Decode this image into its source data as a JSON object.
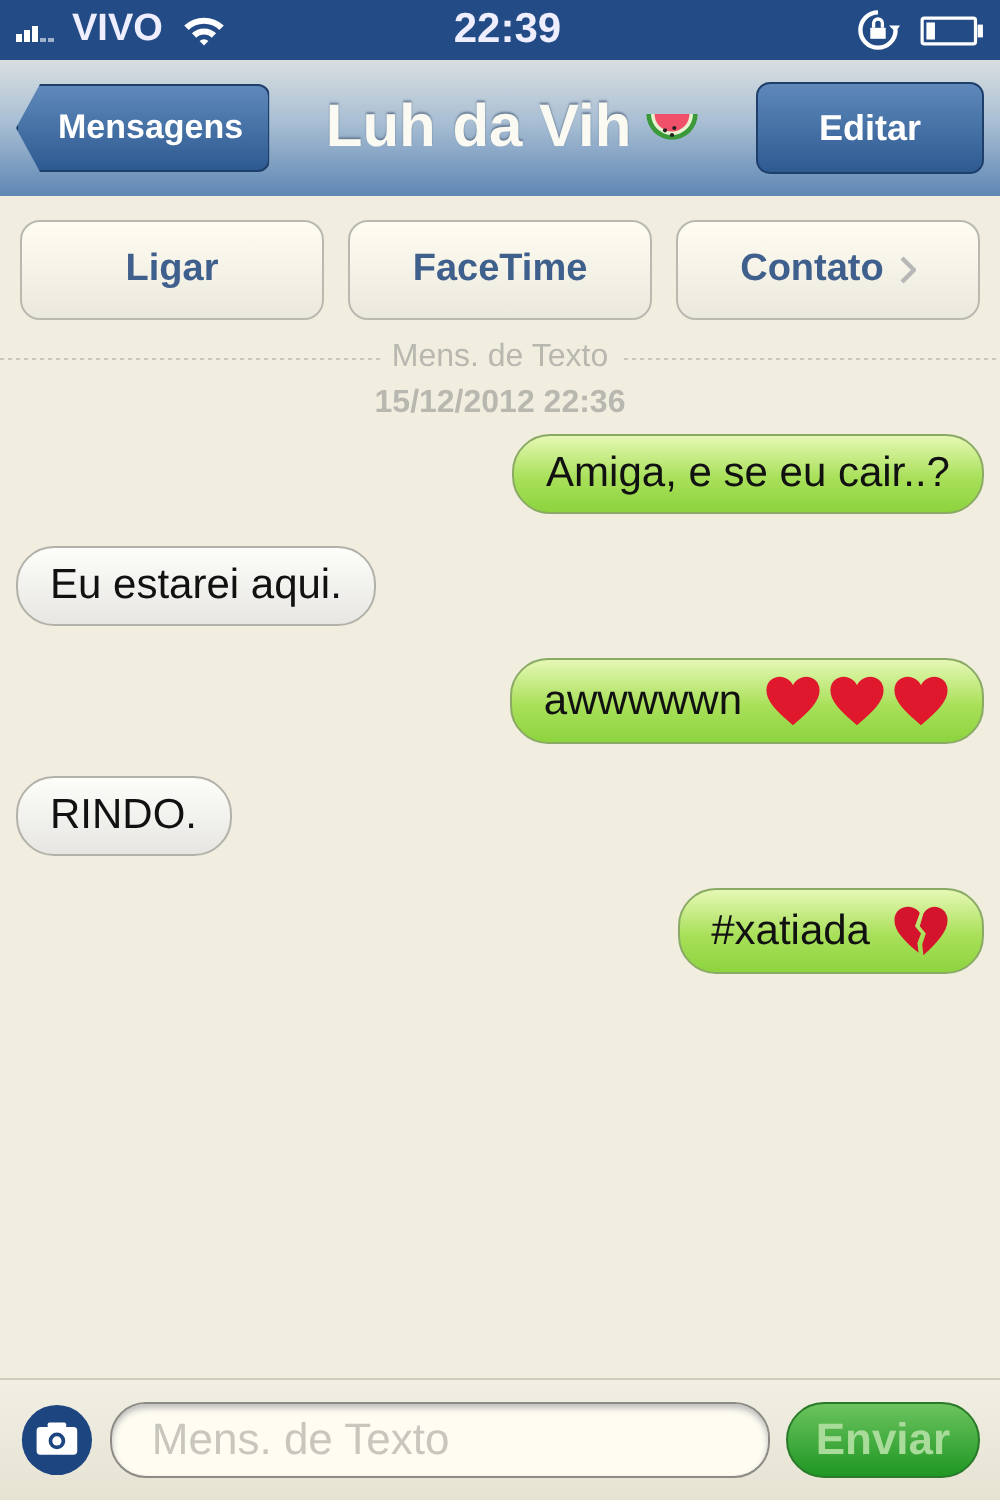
{
  "status_bar": {
    "carrier": "VIVO",
    "time": "22:39"
  },
  "nav": {
    "back": "Mensagens",
    "title": "Luh da Vih",
    "title_emoji": {
      "kind": "watermelon"
    },
    "edit": "Editar"
  },
  "actions": [
    {
      "label": "Ligar",
      "chevron": false
    },
    {
      "label": "FaceTime",
      "chevron": false
    },
    {
      "label": "Contato",
      "chevron": true
    }
  ],
  "thread": {
    "label": "Mens. de Texto",
    "date": "15/12/2012 22:36"
  },
  "messages": [
    {
      "kind": "sent",
      "text": "Amiga, e se eu cair..?"
    },
    {
      "kind": "received",
      "text": "Eu estarei aqui."
    },
    {
      "kind": "sent",
      "text": "awwwwwn",
      "emoji": [
        {
          "kind": "heart"
        },
        {
          "kind": "heart"
        },
        {
          "kind": "heart"
        }
      ]
    },
    {
      "kind": "received",
      "text": "RINDO."
    },
    {
      "kind": "sent",
      "text": "#xatiada",
      "emoji": [
        {
          "kind": "broken-heart"
        }
      ]
    }
  ],
  "composer": {
    "placeholder": "Mens. de Texto",
    "send": "Enviar",
    "send_disabled": true
  }
}
